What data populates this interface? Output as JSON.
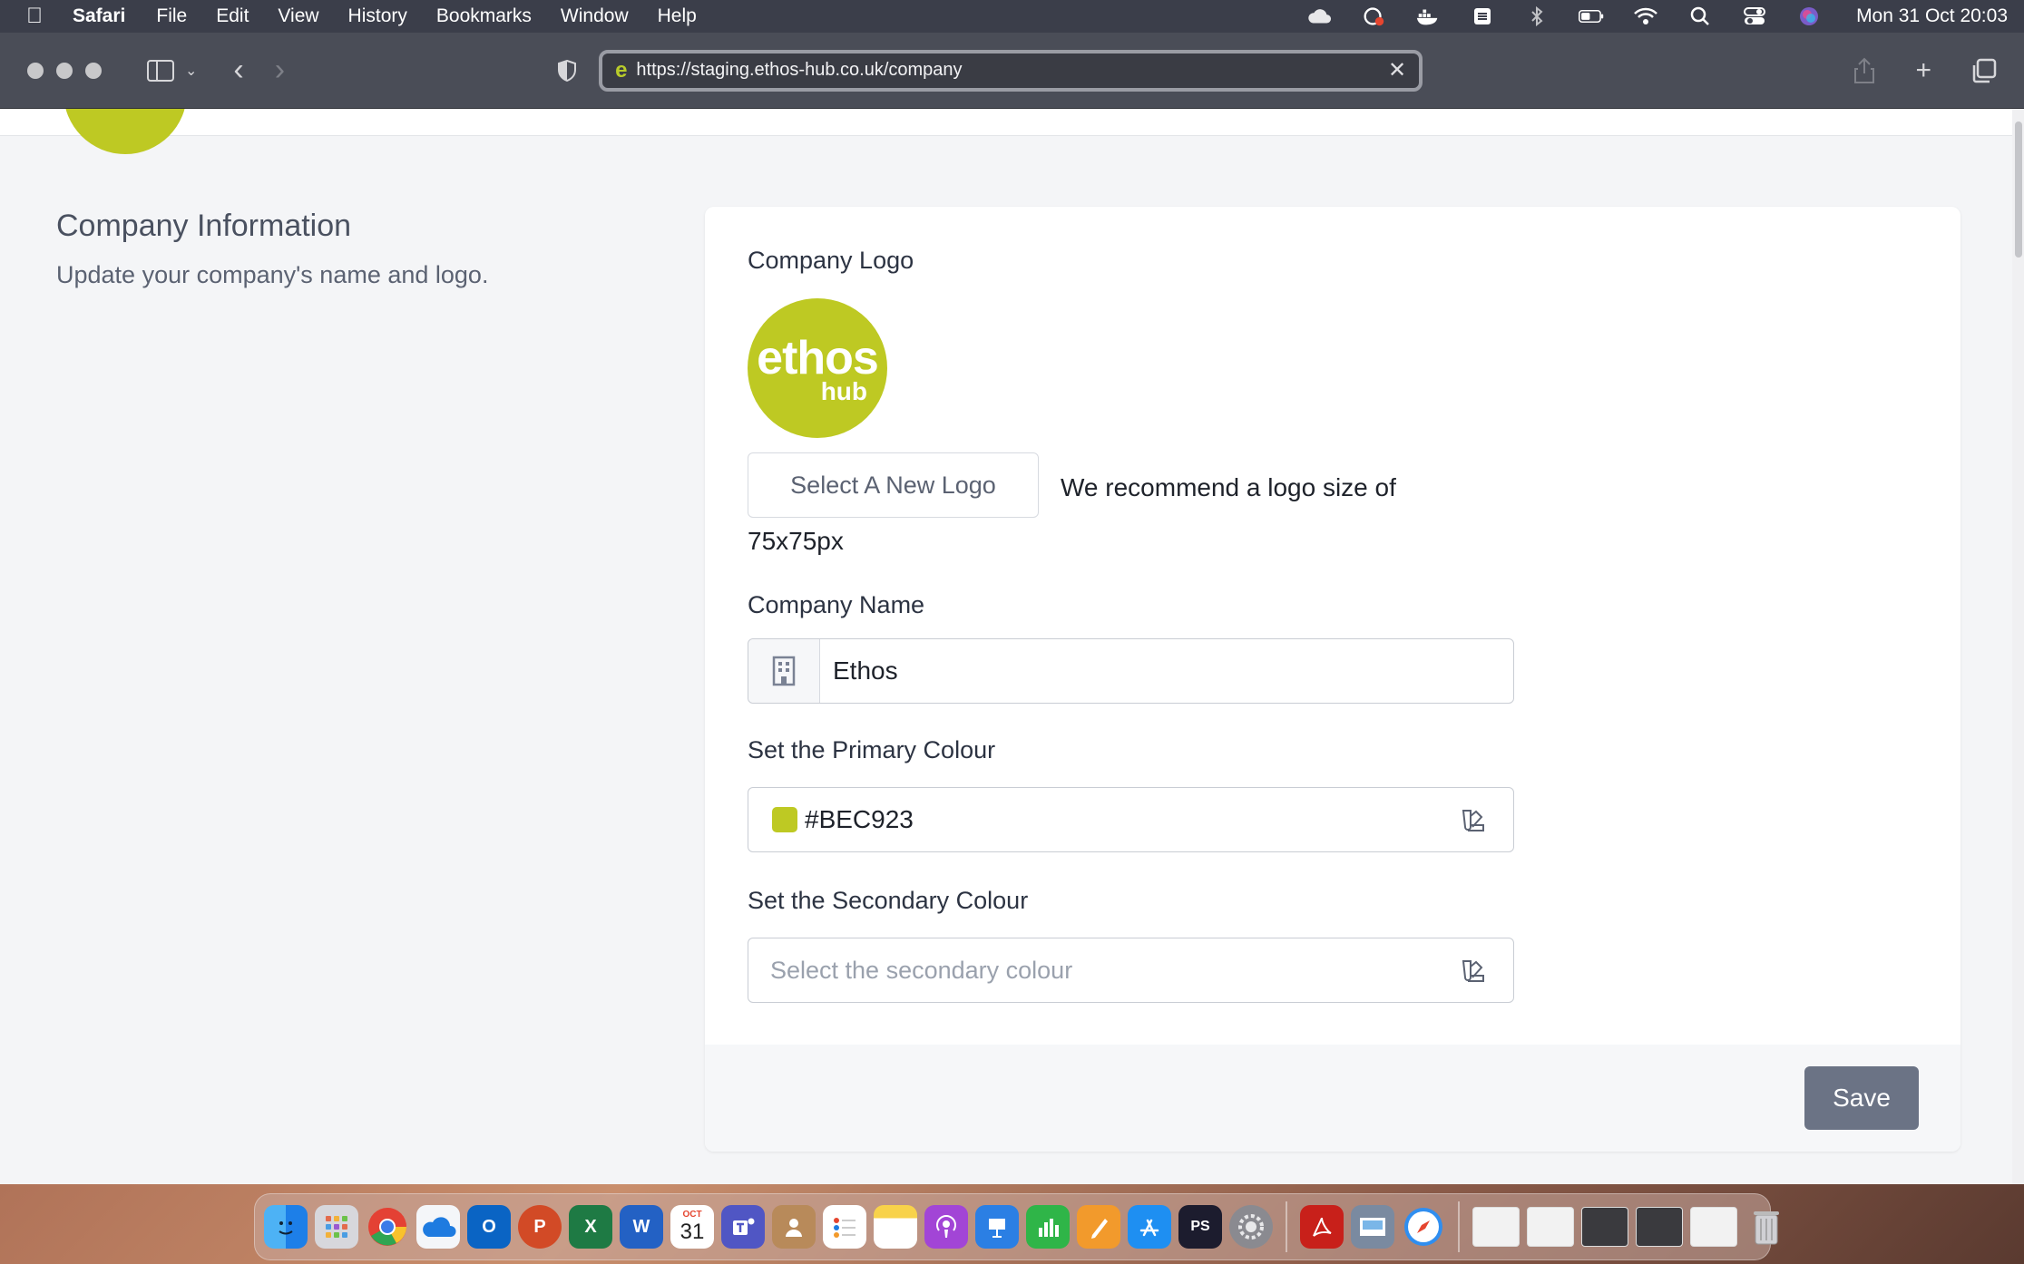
{
  "menubar": {
    "app": "Safari",
    "items": [
      "File",
      "Edit",
      "View",
      "History",
      "Bookmarks",
      "Window",
      "Help"
    ],
    "clock": "Mon 31 Oct  20:03",
    "status_icons": [
      "icloud-icon",
      "creative-cloud-icon",
      "docker-icon",
      "vpn-icon",
      "bluetooth-icon",
      "battery-icon",
      "wifi-icon",
      "spotlight-icon",
      "control-center-icon",
      "siri-icon"
    ]
  },
  "browser": {
    "url": "https://staging.ethos-hub.co.uk/company"
  },
  "page": {
    "section_title": "Company Information",
    "section_subtitle": "Update your company's name and logo.",
    "logo_label": "Company Logo",
    "logo_text_main": "ethos",
    "logo_text_sub": "hub",
    "select_logo_button": "Select A New Logo",
    "logo_recommendation_line1": "We recommend a logo size of",
    "logo_recommendation_line2": "75x75px",
    "company_name_label": "Company Name",
    "company_name_value": "Ethos",
    "primary_colour_label": "Set the Primary Colour",
    "primary_colour_value": "#BEC923",
    "secondary_colour_label": "Set the Secondary Colour",
    "secondary_colour_placeholder": "Select the secondary colour",
    "save_button": "Save"
  },
  "colors": {
    "brand": "#bec923",
    "save_button": "#6b7385"
  },
  "dock": {
    "calendar_month": "OCT",
    "calendar_day": "31",
    "word_letter": "W",
    "excel_letter": "X",
    "powerpoint_letter": "P",
    "outlook_letter": "O",
    "photoshop_letters": "PS"
  }
}
